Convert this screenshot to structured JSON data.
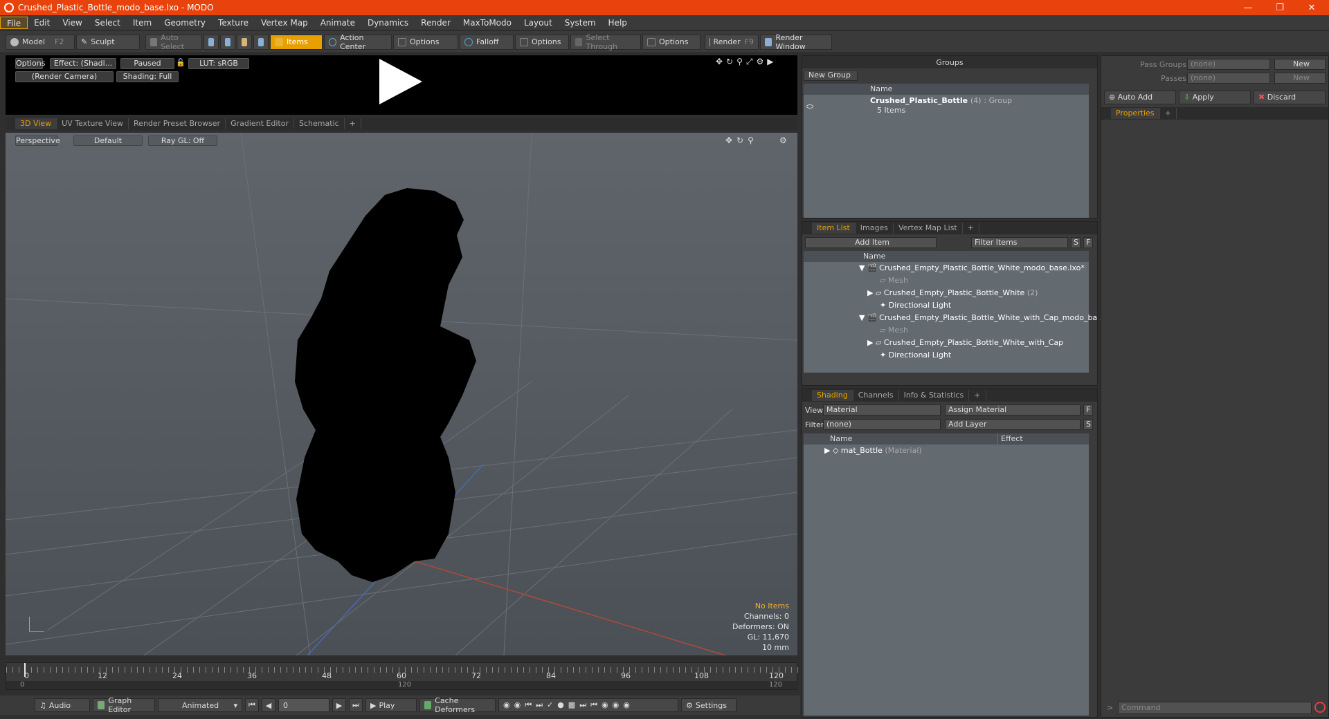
{
  "window": {
    "title": "Crushed_Plastic_Bottle_modo_base.lxo - MODO"
  },
  "menu": [
    "File",
    "Edit",
    "View",
    "Select",
    "Item",
    "Geometry",
    "Texture",
    "Vertex Map",
    "Animate",
    "Dynamics",
    "Render",
    "MaxToModo",
    "Layout",
    "System",
    "Help"
  ],
  "toolbar": {
    "model": "Model",
    "model_key": "F2",
    "sculpt": "Sculpt",
    "auto_select": "Auto Select",
    "items": "Items",
    "action_center": "Action Center",
    "options1": "Options",
    "falloff": "Falloff",
    "options2": "Options",
    "select_through": "Select Through",
    "options3": "Options",
    "render": "Render",
    "render_key": "F9",
    "render_window": "Render Window"
  },
  "preview": {
    "options": "Options",
    "effect": "Effect: (Shadi...",
    "paused": "Paused",
    "lut": "LUT: sRGB",
    "camera": "(Render Camera)",
    "shading": "Shading: Full"
  },
  "view_tabs": [
    "3D View",
    "UV Texture View",
    "Render Preset Browser",
    "Gradient Editor",
    "Schematic",
    "+"
  ],
  "viewport": {
    "perspective": "Perspective",
    "default": "Default",
    "raygl": "Ray GL: Off",
    "stats": {
      "no_items": "No Items",
      "channels": "Channels: 0",
      "deformers": "Deformers: ON",
      "gl": "GL: 11,670",
      "unit": "10 mm"
    }
  },
  "timeline": {
    "ticks": [
      "0",
      "12",
      "24",
      "36",
      "48",
      "60",
      "72",
      "84",
      "96",
      "108",
      "120"
    ],
    "sub_left": "0",
    "sub_mid": "120",
    "sub_right": "120"
  },
  "bottombar": {
    "audio": "Audio",
    "graph_editor": "Graph Editor",
    "animated": "Animated",
    "frame": "0",
    "play": "Play",
    "cache": "Cache Deformers",
    "settings": "Settings"
  },
  "groups": {
    "title": "Groups",
    "new_group": "New Group",
    "col_name": "Name",
    "group_name": "Crushed_Plastic_Bottle",
    "group_count": "(4)",
    "group_type": ": Group",
    "group_items": "5 Items"
  },
  "itemlist": {
    "tabs": [
      "Item List",
      "Images",
      "Vertex Map List",
      "+"
    ],
    "add_item": "Add Item",
    "filter": "Filter Items",
    "s": "S",
    "f": "F",
    "col_name": "Name",
    "rows": [
      {
        "label": "Crushed_Empty_Plastic_Bottle_White_modo_base.lxo*"
      },
      {
        "label": "Mesh"
      },
      {
        "label": "Crushed_Empty_Plastic_Bottle_White",
        "count": "(2)"
      },
      {
        "label": "Directional Light"
      },
      {
        "label": "Crushed_Empty_Plastic_Bottle_White_with_Cap_modo_ba ..."
      },
      {
        "label": "Mesh"
      },
      {
        "label": "Crushed_Empty_Plastic_Bottle_White_with_Cap"
      },
      {
        "label": "Directional Light"
      }
    ]
  },
  "shading": {
    "tabs": [
      "Shading",
      "Channels",
      "Info & Statistics",
      "+"
    ],
    "view_label": "View",
    "view_value": "Material",
    "assign": "Assign Material",
    "f": "F",
    "filter_label": "Filter",
    "filter_value": "(none)",
    "add_layer": "Add Layer",
    "s": "S",
    "col_name": "Name",
    "col_effect": "Effect",
    "row_name": "mat_Bottle",
    "row_type": "(Material)"
  },
  "right": {
    "pass_groups": "Pass Groups",
    "pass_groups_value": "(none)",
    "new1": "New",
    "passes": "Passes",
    "passes_value": "(none)",
    "new2": "New",
    "auto_add": "Auto Add",
    "apply": "Apply",
    "discard": "Discard",
    "properties": "Properties",
    "command": "Command"
  }
}
